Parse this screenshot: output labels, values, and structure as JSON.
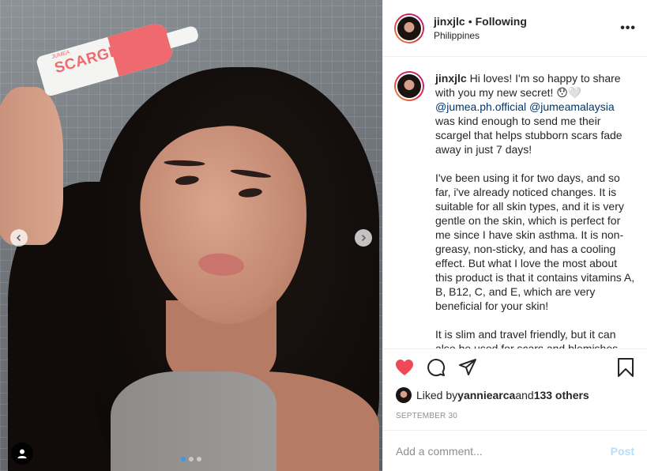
{
  "header": {
    "username": "jinxjlc",
    "separator": "•",
    "follow_status": "Following",
    "location": "Philippines",
    "more_label": "•••"
  },
  "media": {
    "product_brand": "JUMEA",
    "product_name": "SCARGEL",
    "carousel_count": 3,
    "carousel_active": 1
  },
  "caption": {
    "username": "jinxjlc",
    "line1": " Hi loves! I'm so happy to share with you my new secret! 😯🤍",
    "mention1": "@jumea.ph.official",
    "mention2": "@jumeamalaysia",
    "line2": " was kind enough to send me their scargel that helps stubborn scars fade away in just 7 days!",
    "para2": "I've been using it for two days, and so far, i've already noticed changes. It is suitable for all skin types, and it is very gentle on the skin, which is perfect for me since I have skin asthma. It is non-greasy, non-sticky, and has a cooling effect. But what I love the most about this product is that it contains vitamins A, B, B12, C, and E, which are very beneficial for your skin!",
    "para3": "It is slim and travel friendly, but it can also be used for scars and blemishes, and it..."
  },
  "likes": {
    "prefix": "Liked by ",
    "user": "yanniearca",
    "conj": " and ",
    "others": "133 others"
  },
  "date": "SEPTEMBER 30",
  "comment": {
    "placeholder": "Add a comment...",
    "post_label": "Post"
  },
  "colors": {
    "heart": "#ed4956",
    "link": "#00376b",
    "post_disabled": "#b2dffc"
  }
}
